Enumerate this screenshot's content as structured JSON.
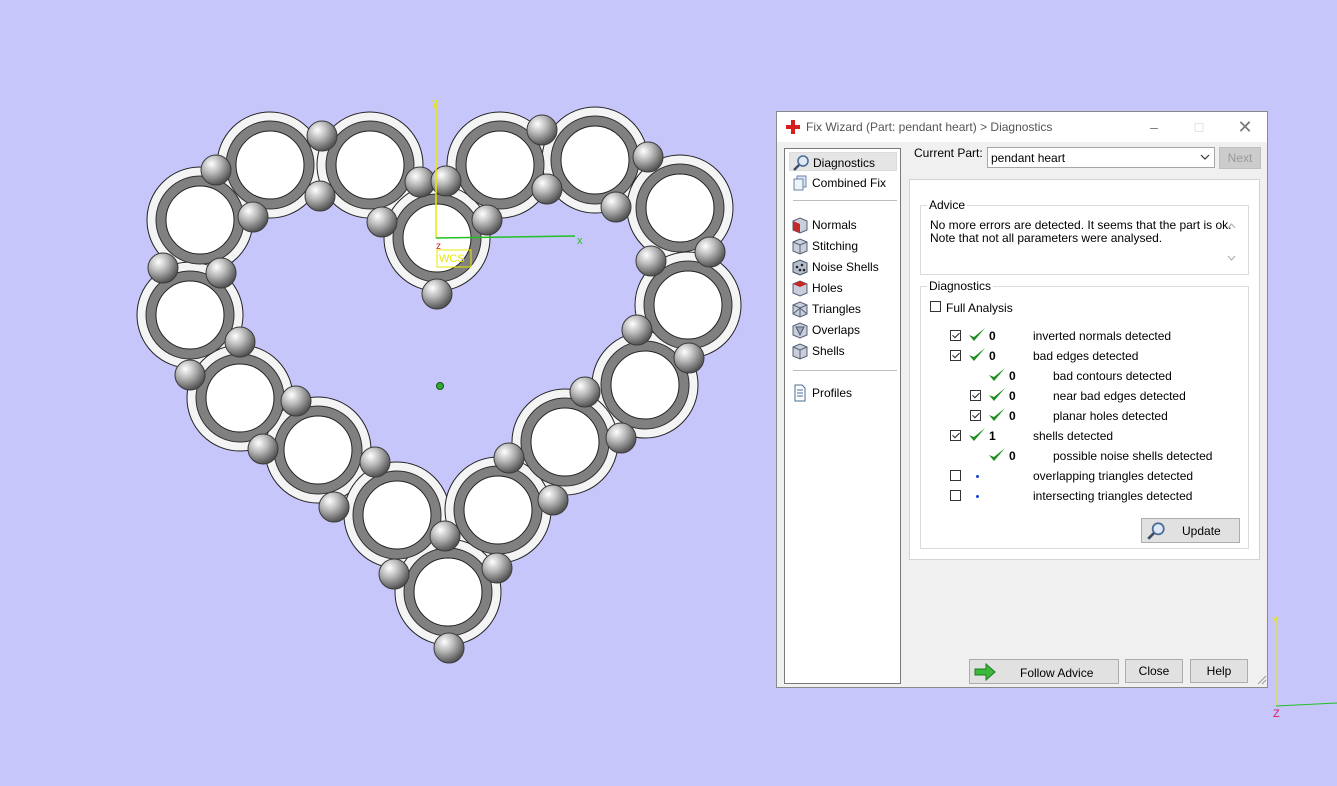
{
  "window": {
    "title": "Fix Wizard (Part: pendant heart) > Diagnostics",
    "brand_color": "#d62020"
  },
  "nav": {
    "items": [
      {
        "label": "Diagnostics",
        "icon": "magnifier-icon",
        "selected": true
      },
      {
        "label": "Combined Fix",
        "icon": "layers-icon"
      },
      {
        "label": "Normals",
        "icon": "normals-cube-icon"
      },
      {
        "label": "Stitching",
        "icon": "stitching-cube-icon"
      },
      {
        "label": "Noise Shells",
        "icon": "noise-shells-icon"
      },
      {
        "label": "Holes",
        "icon": "holes-cube-icon"
      },
      {
        "label": "Triangles",
        "icon": "triangles-cube-icon"
      },
      {
        "label": "Overlaps",
        "icon": "overlaps-cube-icon"
      },
      {
        "label": "Shells",
        "icon": "shells-cube-icon"
      },
      {
        "label": "Profiles",
        "icon": "document-icon"
      }
    ]
  },
  "current_part": {
    "label": "Current Part:",
    "value": "pendant heart",
    "next_label": "Next"
  },
  "advice": {
    "title": "Advice",
    "lines": [
      "No more errors are detected. It seems that the part is ok.",
      "Note that not all parameters were analysed."
    ]
  },
  "diagnostics": {
    "title": "Diagnostics",
    "full_analysis_label": "Full Analysis",
    "full_analysis_checked": false,
    "rows": [
      {
        "label": "inverted normals detected",
        "count": "0",
        "checked": true,
        "has_checkbox": true,
        "status": "ok",
        "indent": 0
      },
      {
        "label": "bad edges detected",
        "count": "0",
        "checked": true,
        "has_checkbox": true,
        "status": "ok",
        "indent": 0
      },
      {
        "label": "bad contours detected",
        "count": "0",
        "checked": false,
        "has_checkbox": false,
        "status": "ok",
        "indent": 1
      },
      {
        "label": "near bad edges detected",
        "count": "0",
        "checked": true,
        "has_checkbox": true,
        "status": "ok",
        "indent": 1
      },
      {
        "label": "planar holes detected",
        "count": "0",
        "checked": true,
        "has_checkbox": true,
        "status": "ok",
        "indent": 1
      },
      {
        "label": "shells detected",
        "count": "1",
        "checked": true,
        "has_checkbox": true,
        "status": "ok",
        "indent": 0
      },
      {
        "label": "possible noise shells detected",
        "count": "0",
        "checked": false,
        "has_checkbox": false,
        "status": "ok",
        "indent": 1
      },
      {
        "label": "overlapping triangles detected",
        "count": "",
        "checked": false,
        "has_checkbox": true,
        "status": "none",
        "indent": 0
      },
      {
        "label": "intersecting triangles detected",
        "count": "",
        "checked": false,
        "has_checkbox": true,
        "status": "none",
        "indent": 0
      }
    ],
    "update_label": "Update"
  },
  "footer": {
    "follow_advice_label": "Follow Advice",
    "close_label": "Close",
    "help_label": "Help"
  },
  "viewport": {
    "background": "#c6c6fb",
    "axis_y_label": "y",
    "axis_x_label": "x",
    "axis_z_label": "z",
    "wcs_label": "WCS",
    "corner_y_label": "Y",
    "corner_z_label": "Z"
  }
}
